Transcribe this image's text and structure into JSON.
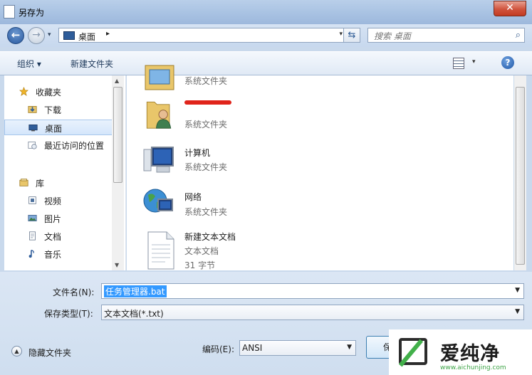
{
  "window": {
    "title": "另存为",
    "close_glyph": "✕"
  },
  "address": {
    "back_glyph": "←",
    "forward_glyph": "→",
    "location": "桌面",
    "search_placeholder": "搜索 桌面"
  },
  "toolbar": {
    "organize": "组织 ▾",
    "new_folder": "新建文件夹",
    "help": "?"
  },
  "nav": {
    "favorites": {
      "label": "收藏夹",
      "items": [
        {
          "label": "下载"
        },
        {
          "label": "桌面"
        },
        {
          "label": "最近访问的位置"
        }
      ]
    },
    "libraries": {
      "label": "库",
      "items": [
        {
          "label": "视频"
        },
        {
          "label": "图片"
        },
        {
          "label": "文档"
        },
        {
          "label": "音乐"
        }
      ]
    }
  },
  "files": [
    {
      "name": "",
      "type": "系统文件夹",
      "icon": "library-folder-icon"
    },
    {
      "name": "",
      "type": "系统文件夹",
      "icon": "user-folder-icon"
    },
    {
      "name": "计算机",
      "type": "系统文件夹",
      "icon": "computer-icon"
    },
    {
      "name": "网络",
      "type": "系统文件夹",
      "icon": "network-icon"
    },
    {
      "name": "新建文本文档",
      "type": "文本文档",
      "size": "31 字节",
      "icon": "text-document-icon"
    }
  ],
  "form": {
    "filename_label": "文件名(N):",
    "filename_value": "任务管理器.bat",
    "savetype_label": "保存类型(T):",
    "savetype_value": "文本文档(*.txt)",
    "encoding_label": "编码(E):",
    "encoding_value": "ANSI",
    "hide_folders": "隐藏文件夹",
    "save_button": "保"
  },
  "watermark": {
    "brand": "爱纯净",
    "url": "www.aichunjing.com"
  },
  "colors": {
    "accent": "#3399ff",
    "redacted": "#e0241b",
    "watermark_green": "#42b04a"
  }
}
